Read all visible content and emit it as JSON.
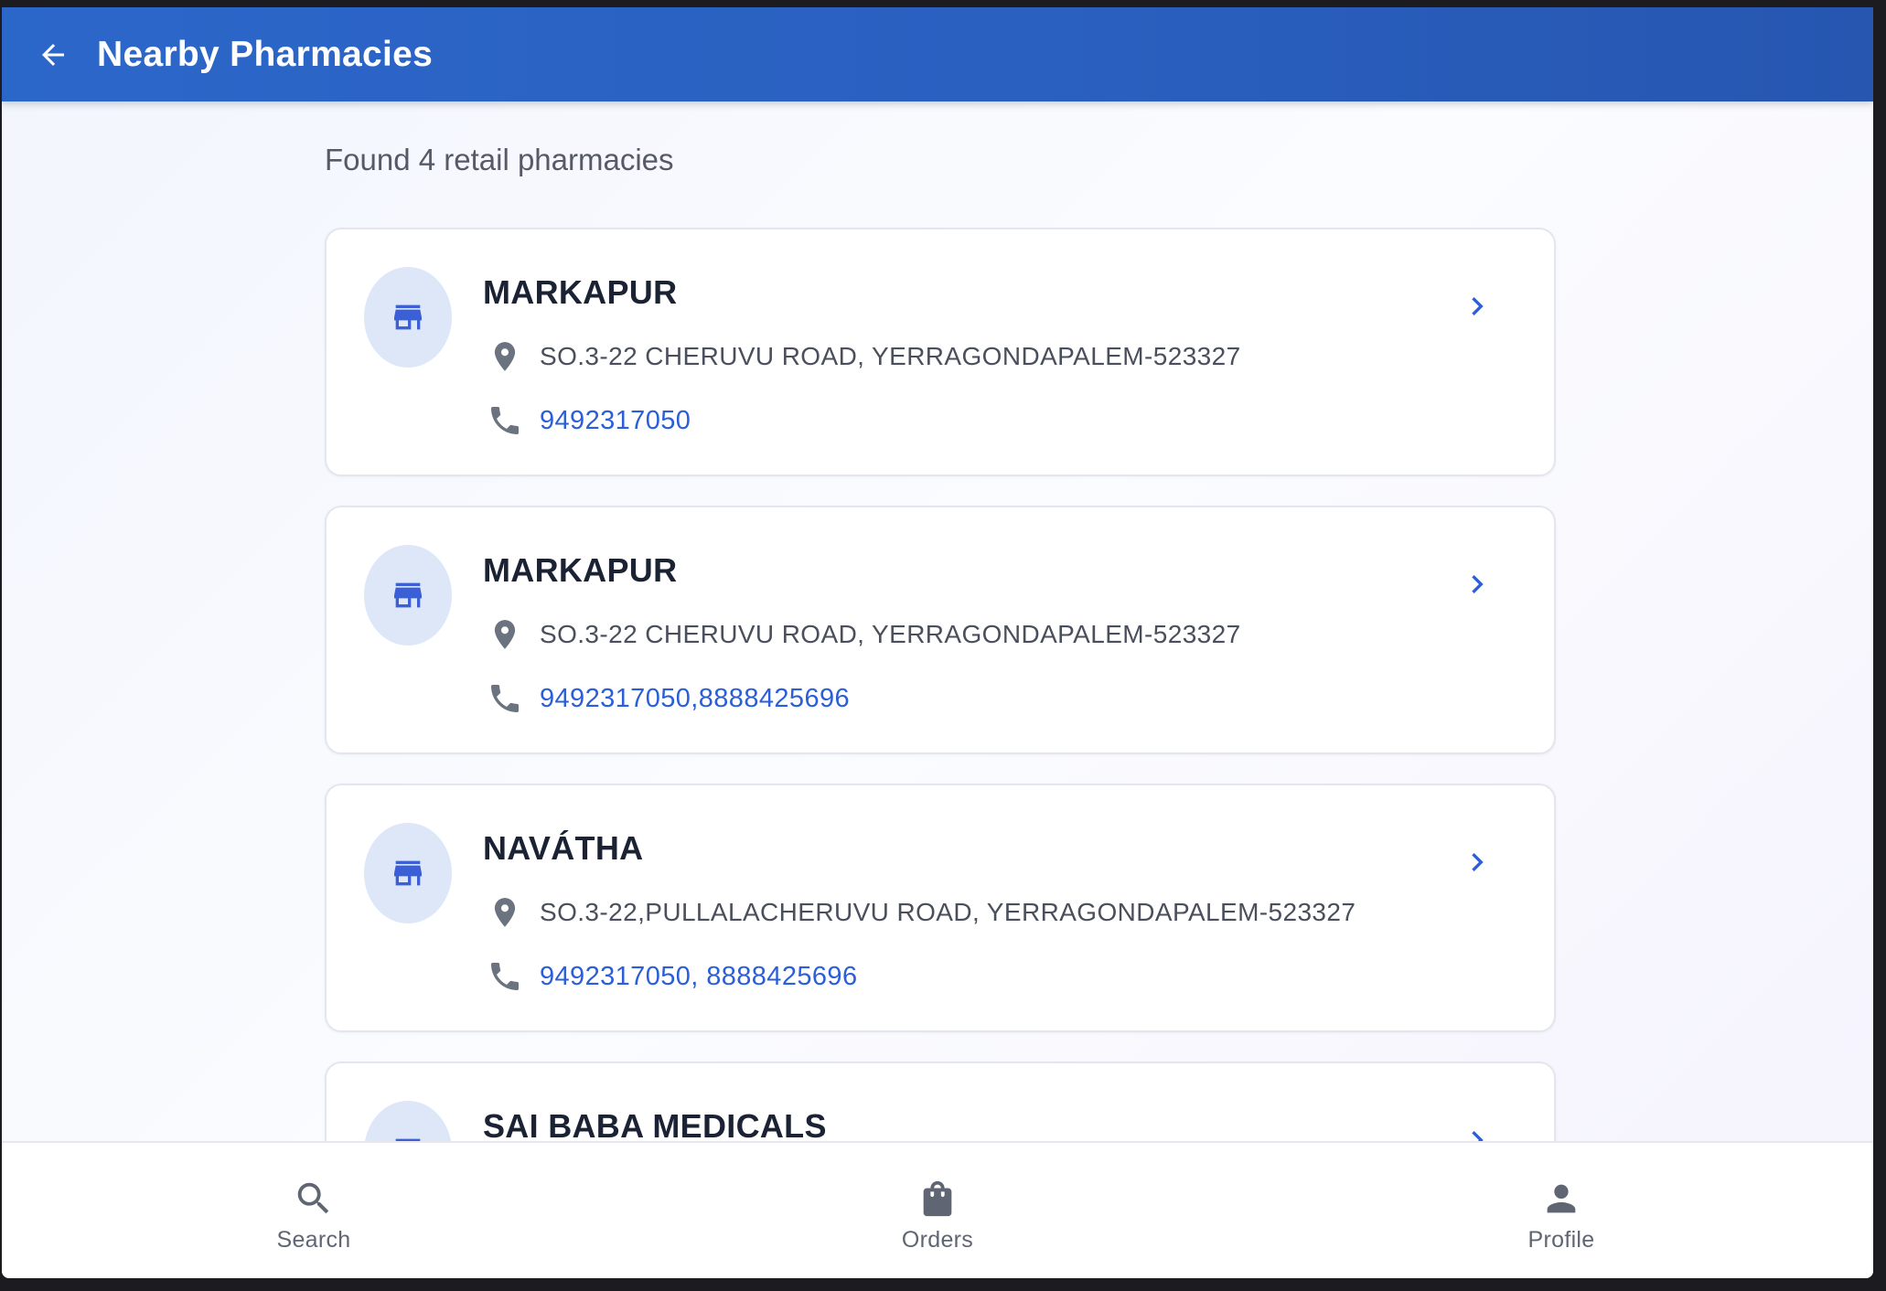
{
  "appbar": {
    "title": "Nearby Pharmacies",
    "back_icon": "arrow-left-icon"
  },
  "summary": {
    "count_text": "Found 4 retail pharmacies"
  },
  "pharmacies": [
    {
      "name": "MARKAPUR",
      "address": "SO.3-22 CHERUVU ROAD, YERRAGONDAPALEM-523327",
      "phone": "9492317050"
    },
    {
      "name": "MARKAPUR",
      "address": "SO.3-22 CHERUVU ROAD, YERRAGONDAPALEM-523327",
      "phone": "9492317050,8888425696"
    },
    {
      "name": "NAVÁTHA",
      "address": "SO.3-22,PULLALACHERUVU ROAD, YERRAGONDAPALEM-523327",
      "phone": "9492317050, 8888425696"
    },
    {
      "name": "SAI BABA MEDICALS",
      "address": "",
      "phone": ""
    }
  ],
  "bottom_nav": [
    {
      "label": "Search",
      "icon": "search-icon"
    },
    {
      "label": "Orders",
      "icon": "shopping-bag-icon"
    },
    {
      "label": "Profile",
      "icon": "person-icon"
    }
  ],
  "colors": {
    "appbar": "#2a5fbf",
    "accent": "#2b5fd9",
    "icon_grey": "#6b7280",
    "avatar_bg": "#dde7f8"
  }
}
